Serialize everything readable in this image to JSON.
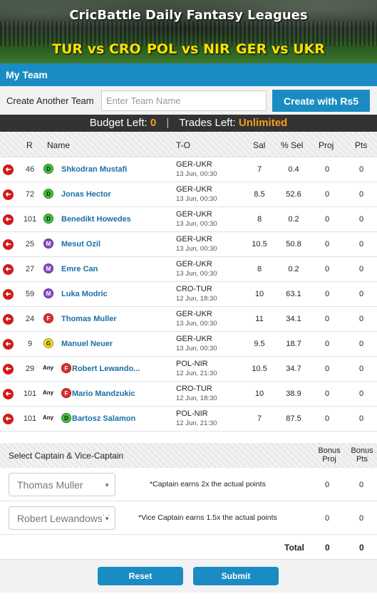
{
  "banner": {
    "title": "CricBattle Daily Fantasy Leagues",
    "matches": [
      "TUR vs CRO",
      "POL vs NIR",
      "GER vs UKR"
    ]
  },
  "my_team": {
    "title": "My Team"
  },
  "create": {
    "label": "Create Another Team",
    "placeholder": "Enter Team Name",
    "button": "Create with Rs5"
  },
  "budget": {
    "budget_label": "Budget Left:",
    "budget_value": "0",
    "trades_label": "Trades Left:",
    "trades_value": "Unlimited"
  },
  "columns": [
    "R",
    "Name",
    "T-O",
    "Sal",
    "% Sel",
    "Proj",
    "Pts"
  ],
  "players": [
    {
      "rank": "46",
      "any": "",
      "pos": "D",
      "name": "Shkodran Mustafi",
      "match": "GER-UKR",
      "time": "13 Jun, 00:30",
      "sal": "7",
      "sel": "0.4",
      "proj": "0",
      "pts": "0"
    },
    {
      "rank": "72",
      "any": "",
      "pos": "D",
      "name": "Jonas Hector",
      "match": "GER-UKR",
      "time": "13 Jun, 00:30",
      "sal": "8.5",
      "sel": "52.6",
      "proj": "0",
      "pts": "0"
    },
    {
      "rank": "101",
      "any": "",
      "pos": "D",
      "name": "Benedikt Howedes",
      "match": "GER-UKR",
      "time": "13 Jun, 00:30",
      "sal": "8",
      "sel": "0.2",
      "proj": "0",
      "pts": "0"
    },
    {
      "rank": "25",
      "any": "",
      "pos": "M",
      "name": "Mesut Ozil",
      "match": "GER-UKR",
      "time": "13 Jun, 00:30",
      "sal": "10.5",
      "sel": "50.8",
      "proj": "0",
      "pts": "0"
    },
    {
      "rank": "27",
      "any": "",
      "pos": "M",
      "name": "Emre Can",
      "match": "GER-UKR",
      "time": "13 Jun, 00:30",
      "sal": "8",
      "sel": "0.2",
      "proj": "0",
      "pts": "0"
    },
    {
      "rank": "59",
      "any": "",
      "pos": "M",
      "name": "Luka Modric",
      "match": "CRO-TUR",
      "time": "12 Jun, 18:30",
      "sal": "10",
      "sel": "63.1",
      "proj": "0",
      "pts": "0"
    },
    {
      "rank": "24",
      "any": "",
      "pos": "F",
      "name": "Thomas Muller",
      "match": "GER-UKR",
      "time": "13 Jun, 00:30",
      "sal": "11",
      "sel": "34.1",
      "proj": "0",
      "pts": "0"
    },
    {
      "rank": "9",
      "any": "",
      "pos": "G",
      "name": "Manuel Neuer",
      "match": "GER-UKR",
      "time": "13 Jun, 00:30",
      "sal": "9.5",
      "sel": "18.7",
      "proj": "0",
      "pts": "0"
    },
    {
      "rank": "29",
      "any": "Any",
      "pos": "F",
      "name": "Robert Lewando...",
      "match": "POL-NIR",
      "time": "12 Jun, 21:30",
      "sal": "10.5",
      "sel": "34.7",
      "proj": "0",
      "pts": "0"
    },
    {
      "rank": "101",
      "any": "Any",
      "pos": "F",
      "name": "Mario Mandzukic",
      "match": "CRO-TUR",
      "time": "12 Jun, 18:30",
      "sal": "10",
      "sel": "38.9",
      "proj": "0",
      "pts": "0"
    },
    {
      "rank": "101",
      "any": "Any",
      "pos": "D",
      "name": "Bartosz Salamon",
      "match": "POL-NIR",
      "time": "12 Jun, 21:30",
      "sal": "7",
      "sel": "87.5",
      "proj": "0",
      "pts": "0"
    }
  ],
  "captain": {
    "title": "Select Captain & Vice-Captain",
    "bonus_proj": "Bonus Proj",
    "bonus_pts": "Bonus Pts",
    "captain_select": "Thomas Muller",
    "captain_note": "*Captain earns 2x the actual points",
    "captain_proj": "0",
    "captain_pts": "0",
    "vice_select": "Robert Lewandowski",
    "vice_note": "*Vice Captain earns 1.5x the actual points",
    "vice_proj": "0",
    "vice_pts": "0",
    "total_label": "Total",
    "total_proj": "0",
    "total_pts": "0"
  },
  "actions": {
    "reset": "Reset",
    "submit": "Submit"
  },
  "colors": {
    "accent": "#1a8cc3",
    "highlight": "#ff9a1a",
    "banner_text": "#ffe100"
  }
}
